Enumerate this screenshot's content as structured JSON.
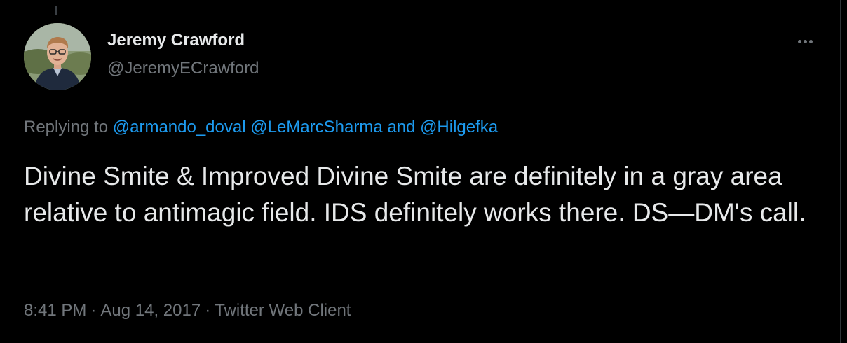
{
  "tweet": {
    "author": {
      "display_name": "Jeremy Crawford",
      "handle": "@JeremyECrawford",
      "avatar_icon": "profile-photo"
    },
    "more_icon": "ellipsis-icon",
    "replying": {
      "prefix": "Replying to",
      "mention_1": "@armando_doval",
      "mention_2": "@LeMarcSharma",
      "conjunction": "and",
      "mention_3": "@Hilgefka"
    },
    "text": "Divine Smite & Improved Divine Smite are definitely in a gray area relative to antimagic field. IDS definitely works there. DS—DM's call.",
    "meta": {
      "time": "8:41 PM",
      "separator": "·",
      "date": "Aug 14, 2017",
      "source": "Twitter Web Client"
    }
  },
  "colors": {
    "background": "#000000",
    "text_primary": "#e7e9ea",
    "text_secondary": "#71767b",
    "link": "#1d9bf0"
  }
}
